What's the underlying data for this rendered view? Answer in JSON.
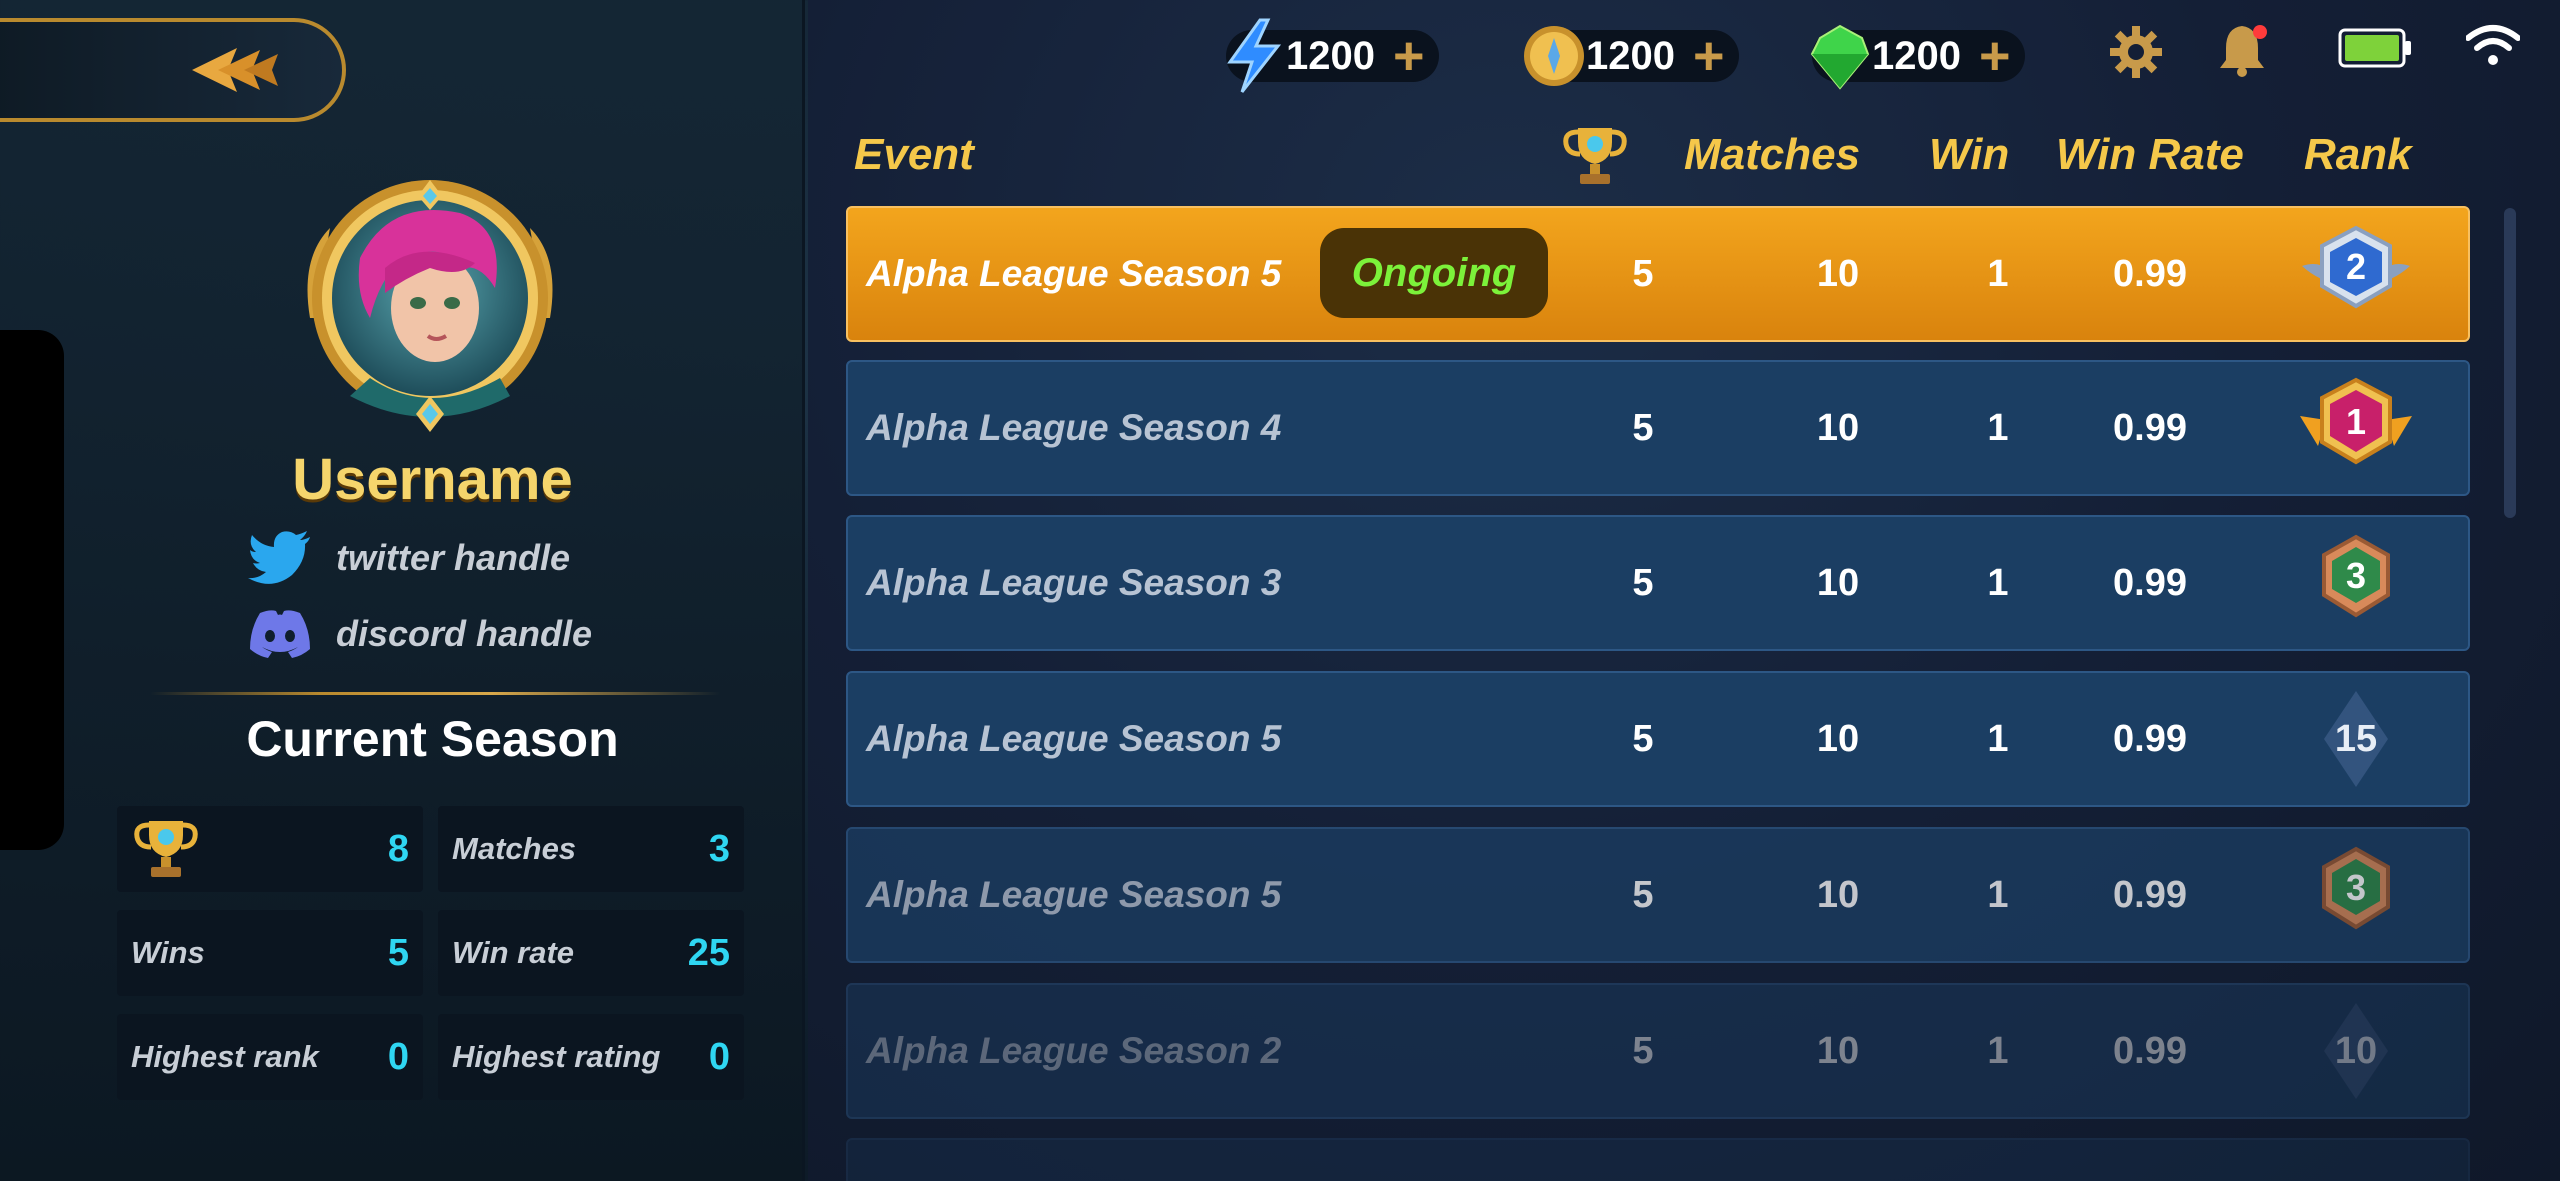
{
  "profile": {
    "username": "Username",
    "twitter": "twitter handle",
    "discord": "discord handle",
    "section_title": "Current Season"
  },
  "stats": [
    {
      "label": "",
      "icon": "trophy-icon",
      "value": "8"
    },
    {
      "label": "Matches",
      "value": "3"
    },
    {
      "label": "Wins",
      "value": "5"
    },
    {
      "label": "Win rate",
      "value": "25"
    },
    {
      "label": "Highest rank",
      "value": "0"
    },
    {
      "label": "Highest rating",
      "value": "0"
    }
  ],
  "currencies": [
    {
      "icon": "energy-bolt-icon",
      "amount": "1200",
      "color": "#2f8cff"
    },
    {
      "icon": "gold-coin-icon",
      "amount": "1200",
      "color": "#e8b23a"
    },
    {
      "icon": "gem-icon",
      "amount": "1200",
      "color": "#3fd44a"
    }
  ],
  "columns": {
    "event": "Event",
    "matches": "Matches",
    "win": "Win",
    "win_rate": "Win Rate",
    "rank": "Rank"
  },
  "rows": [
    {
      "event": "Alpha League Season 5",
      "status": "Ongoing",
      "trophies": "5",
      "matches": "10",
      "win": "1",
      "win_rate": "0.99",
      "rank": "2",
      "badge": "silver"
    },
    {
      "event": "Alpha League Season 4",
      "status": "",
      "trophies": "5",
      "matches": "10",
      "win": "1",
      "win_rate": "0.99",
      "rank": "1",
      "badge": "gold"
    },
    {
      "event": "Alpha League Season 3",
      "status": "",
      "trophies": "5",
      "matches": "10",
      "win": "1",
      "win_rate": "0.99",
      "rank": "3",
      "badge": "bronze"
    },
    {
      "event": "Alpha League Season 5",
      "status": "",
      "trophies": "5",
      "matches": "10",
      "win": "1",
      "win_rate": "0.99",
      "rank": "15",
      "badge": "plain"
    },
    {
      "event": "Alpha League Season 5",
      "status": "",
      "trophies": "5",
      "matches": "10",
      "win": "1",
      "win_rate": "0.99",
      "rank": "3",
      "badge": "bronze"
    },
    {
      "event": "Alpha League Season 2",
      "status": "",
      "trophies": "5",
      "matches": "10",
      "win": "1",
      "win_rate": "0.99",
      "rank": "10",
      "badge": "plain"
    }
  ]
}
